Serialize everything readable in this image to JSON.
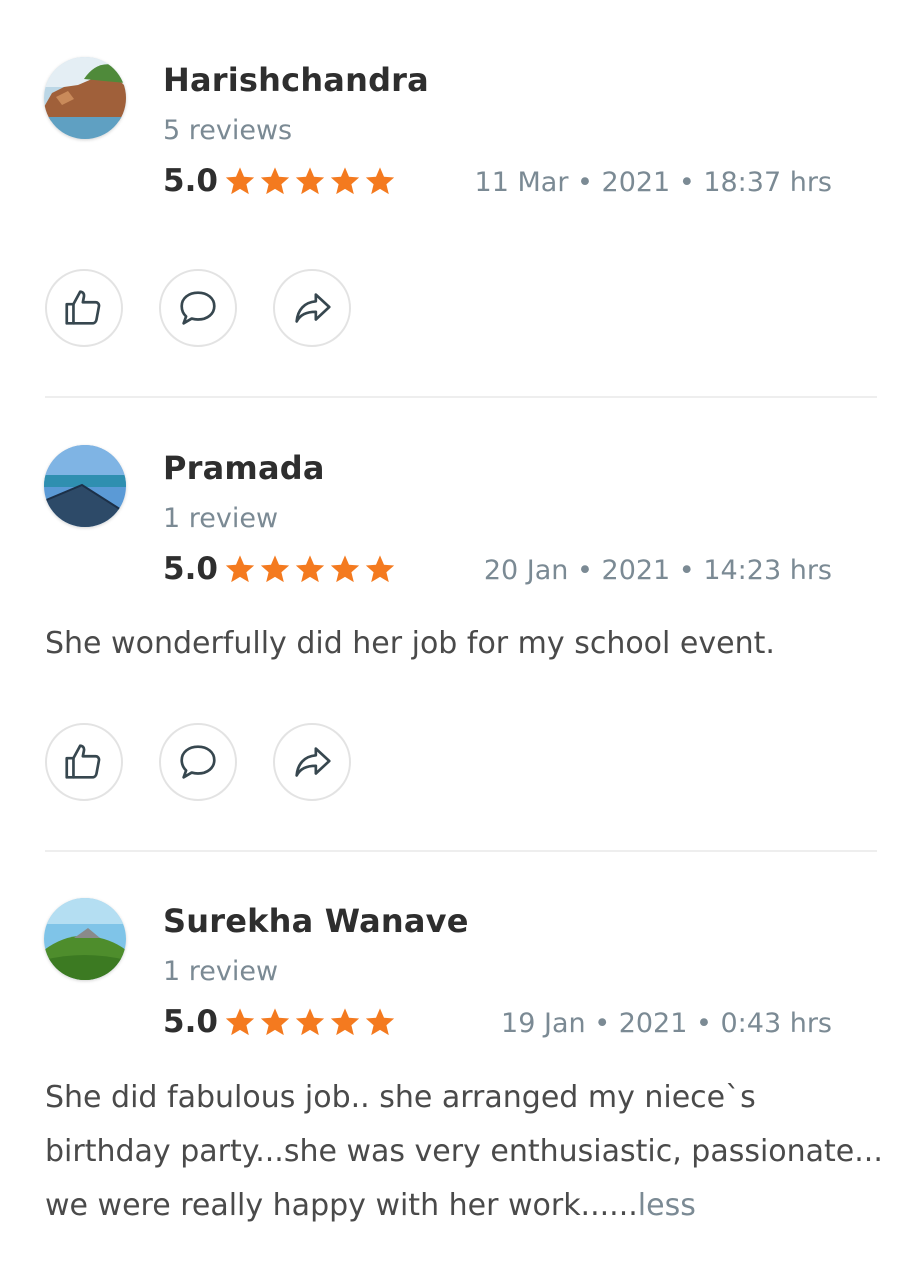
{
  "colors": {
    "star": "#f47a1f",
    "muted": "#7b8a94",
    "text": "#4a4a4a",
    "name": "#2e2e2e"
  },
  "reviews": [
    {
      "name": "Harishchandra",
      "count": "5 reviews",
      "score": "5.0",
      "stars": 5,
      "date": "11 Mar • 2021 • 18:37 hrs",
      "text": "",
      "more": "",
      "avatar": "rock-beach-photo"
    },
    {
      "name": "Pramada",
      "count": "1 review",
      "score": "5.0",
      "stars": 5,
      "date": "20 Jan • 2021 • 14:23 hrs",
      "text": "She wonderfully did her job for my school event.",
      "more": "",
      "avatar": "ocean-pier-photo"
    },
    {
      "name": "Surekha Wanave",
      "count": "1 review",
      "score": "5.0",
      "stars": 5,
      "date": "19 Jan • 2021 • 0:43 hrs",
      "text": "She did fabulous job.. she arranged my niece`s birthday party...she was very enthusiastic, passionate... we were really happy with her work......",
      "more": "less",
      "avatar": "green-hill-photo"
    }
  ],
  "actions": {
    "like": "thumbs-up-icon",
    "comment": "comment-icon",
    "share": "share-icon"
  }
}
